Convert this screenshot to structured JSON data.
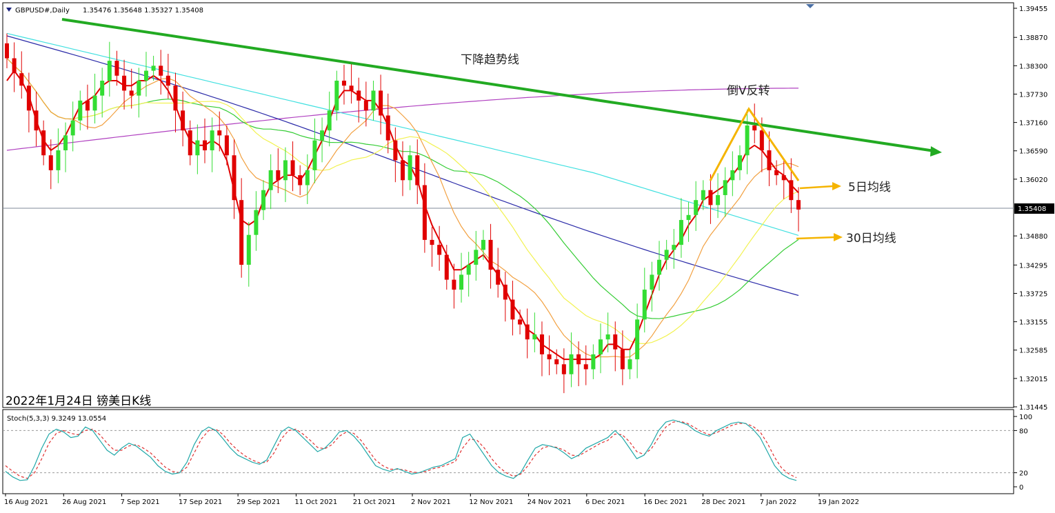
{
  "header": {
    "symbol": "GBPUSD#,Daily",
    "ohlc": "1.35476 1.35648 1.35327 1.35408"
  },
  "caption": "2022年1月24日 镑美日K线",
  "chart_data": {
    "type": "candlestick",
    "price_axis": {
      "ticks": [
        "1.39455",
        "1.38870",
        "1.38300",
        "1.37730",
        "1.37160",
        "1.36590",
        "1.36020",
        "1.35408",
        "1.34880",
        "1.34295",
        "1.33725",
        "1.33155",
        "1.32585",
        "1.32015",
        "1.31445"
      ],
      "ylim": [
        1.31445,
        1.39455
      ],
      "current_price": "1.35408"
    },
    "date_axis": [
      "16 Aug 2021",
      "26 Aug 2021",
      "7 Sep 2021",
      "17 Sep 2021",
      "29 Sep 2021",
      "11 Oct 2021",
      "21 Oct 2021",
      "2 Nov 2021",
      "12 Nov 2021",
      "24 Nov 2021",
      "6 Dec 2021",
      "16 Dec 2021",
      "28 Dec 2021",
      "7 Jan 2022",
      "19 Jan 2022"
    ],
    "candles_close": [
      1.3845,
      1.3815,
      1.379,
      1.374,
      1.37,
      1.365,
      1.362,
      1.366,
      1.369,
      1.372,
      1.376,
      1.374,
      1.377,
      1.38,
      1.384,
      1.381,
      1.378,
      1.377,
      1.38,
      1.382,
      1.383,
      1.381,
      1.379,
      1.374,
      1.37,
      1.365,
      1.368,
      1.366,
      1.37,
      1.369,
      1.365,
      1.356,
      1.343,
      1.349,
      1.354,
      1.358,
      1.362,
      1.36,
      1.364,
      1.361,
      1.359,
      1.362,
      1.368,
      1.37,
      1.374,
      1.38,
      1.379,
      1.378,
      1.376,
      1.374,
      1.378,
      1.373,
      1.368,
      1.364,
      1.36,
      1.365,
      1.359,
      1.348,
      1.347,
      1.345,
      1.34,
      1.338,
      1.341,
      1.343,
      1.346,
      1.348,
      1.342,
      1.339,
      1.336,
      1.332,
      1.331,
      1.328,
      1.329,
      1.325,
      1.324,
      1.323,
      1.321,
      1.325,
      1.323,
      1.322,
      1.325,
      1.328,
      1.329,
      1.326,
      1.322,
      1.324,
      1.332,
      1.338,
      1.341,
      1.344,
      1.346,
      1.347,
      1.352,
      1.353,
      1.356,
      1.358,
      1.355,
      1.357,
      1.36,
      1.362,
      1.365,
      1.371,
      1.37,
      1.366,
      1.362,
      1.361,
      1.36,
      1.356,
      1.3541
    ],
    "ma5_close": [
      1.38,
      1.382,
      1.38,
      1.377,
      1.372,
      1.368,
      1.366,
      1.367,
      1.369,
      1.372,
      1.375,
      1.376,
      1.377,
      1.379,
      1.38,
      1.38,
      1.379,
      1.379,
      1.38,
      1.38,
      1.381,
      1.38,
      1.378,
      1.375,
      1.371,
      1.368,
      1.367,
      1.367,
      1.368,
      1.367,
      1.364,
      1.358,
      1.352,
      1.351,
      1.352,
      1.356,
      1.359,
      1.36,
      1.361,
      1.361,
      1.36,
      1.362,
      1.365,
      1.368,
      1.372,
      1.376,
      1.378,
      1.378,
      1.377,
      1.376,
      1.376,
      1.374,
      1.371,
      1.367,
      1.364,
      1.363,
      1.36,
      1.355,
      1.351,
      1.348,
      1.345,
      1.342,
      1.342,
      1.343,
      1.344,
      1.345,
      1.343,
      1.341,
      1.338,
      1.335,
      1.333,
      1.33,
      1.329,
      1.327,
      1.326,
      1.325,
      1.324,
      1.324,
      1.324,
      1.324,
      1.324,
      1.325,
      1.327,
      1.327,
      1.326,
      1.326,
      1.329,
      1.333,
      1.337,
      1.341,
      1.344,
      1.346,
      1.348,
      1.351,
      1.353,
      1.356,
      1.357,
      1.358,
      1.359,
      1.361,
      1.363,
      1.366,
      1.367,
      1.366,
      1.364,
      1.362,
      1.361,
      1.359,
      1.3575
    ]
  },
  "annotations": {
    "downtrend": "下降趋势线",
    "inverted_v": "倒V反转",
    "ma5": "5日均线",
    "ma30": "30日均线"
  },
  "stoch": {
    "label": "Stoch(5,3,3) 9.3249 13.0554",
    "ticks": [
      "100",
      "80",
      "20",
      "0"
    ],
    "main": [
      22,
      14,
      9,
      10,
      30,
      55,
      75,
      82,
      78,
      70,
      72,
      85,
      80,
      66,
      52,
      45,
      55,
      62,
      58,
      50,
      42,
      30,
      22,
      18,
      20,
      35,
      60,
      78,
      85,
      80,
      68,
      55,
      45,
      40,
      35,
      32,
      38,
      58,
      78,
      85,
      80,
      70,
      60,
      50,
      55,
      65,
      78,
      80,
      72,
      60,
      45,
      30,
      25,
      22,
      26,
      22,
      18,
      20,
      24,
      28,
      30,
      35,
      40,
      70,
      75,
      60,
      45,
      30,
      20,
      15,
      12,
      20,
      38,
      55,
      60,
      58,
      55,
      48,
      40,
      45,
      55,
      60,
      65,
      70,
      80,
      70,
      55,
      40,
      45,
      60,
      80,
      92,
      95,
      92,
      88,
      80,
      75,
      72,
      80,
      85,
      90,
      92,
      90,
      82,
      70,
      50,
      30,
      18,
      12,
      9
    ],
    "signal": [
      30,
      22,
      15,
      12,
      20,
      40,
      62,
      76,
      80,
      76,
      74,
      80,
      82,
      74,
      62,
      52,
      52,
      58,
      60,
      55,
      48,
      38,
      28,
      22,
      20,
      28,
      48,
      68,
      80,
      82,
      74,
      62,
      52,
      44,
      38,
      34,
      35,
      48,
      68,
      80,
      82,
      75,
      66,
      56,
      54,
      60,
      72,
      78,
      76,
      66,
      52,
      38,
      30,
      25,
      25,
      24,
      21,
      20,
      22,
      26,
      28,
      32,
      36,
      55,
      68,
      66,
      55,
      40,
      28,
      20,
      15,
      18,
      30,
      45,
      55,
      58,
      56,
      52,
      45,
      44,
      50,
      56,
      62,
      66,
      75,
      74,
      64,
      50,
      46,
      54,
      70,
      85,
      92,
      93,
      90,
      84,
      78,
      74,
      77,
      82,
      87,
      90,
      90,
      86,
      78,
      62,
      42,
      26,
      18,
      13
    ]
  }
}
